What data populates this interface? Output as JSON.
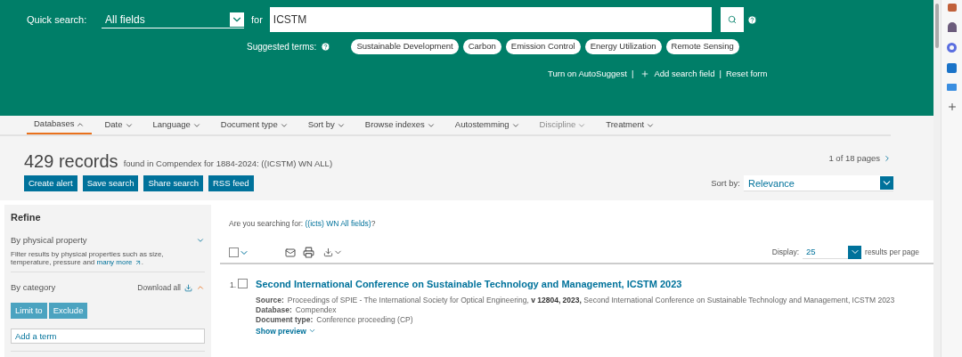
{
  "search": {
    "label": "Quick search:",
    "field": "All fields",
    "for_label": "for",
    "query": "ICSTM",
    "suggested_label": "Suggested terms:",
    "suggested_terms": [
      "Sustainable Development",
      "Carbon",
      "Emission Control",
      "Energy Utilization",
      "Remote Sensing"
    ],
    "links": [
      "Turn on AutoSuggest",
      "Add search field",
      "Reset form"
    ],
    "separators": [
      "|",
      "|"
    ]
  },
  "tabs": [
    {
      "label": "Databases",
      "selected": true,
      "disabled": false
    },
    {
      "label": "Date",
      "selected": false,
      "disabled": false
    },
    {
      "label": "Language",
      "selected": false,
      "disabled": false
    },
    {
      "label": "Document type",
      "selected": false,
      "disabled": false
    },
    {
      "label": "Sort by",
      "selected": false,
      "disabled": false
    },
    {
      "label": "Browse indexes",
      "selected": false,
      "disabled": false
    },
    {
      "label": "Autostemming",
      "selected": false,
      "disabled": false
    },
    {
      "label": "Discipline",
      "selected": false,
      "disabled": true
    },
    {
      "label": "Treatment",
      "selected": false,
      "disabled": false
    }
  ],
  "results_header": {
    "count": "429 records",
    "summary": "found in Compendex for 1884-2024: ((ICSTM) WN ALL)",
    "pages": "1 of 18 pages",
    "actions": [
      "Create alert",
      "Save search",
      "Share search",
      "RSS feed"
    ],
    "sort_label": "Sort by:",
    "sort_value": "Relevance"
  },
  "refine": {
    "title": "Refine",
    "sections": [
      {
        "kind": "info",
        "title": "By physical property",
        "expanded": false,
        "text": "Filter results by physical properties such as size, temperature, pressure and",
        "link": "many more",
        "end": "."
      },
      {
        "kind": "category",
        "title": "By category",
        "expanded": true,
        "download": "Download all",
        "buttons": [
          "Limit to",
          "Exclude"
        ],
        "placeholder": "Add a term"
      }
    ]
  },
  "results": {
    "suggestion_label": "Are you searching for:",
    "suggestion_link": "((icts) WN All fields)",
    "suggestion_end": "?",
    "select_all_checked": false,
    "display_label": "Display:",
    "display_value": "25",
    "display_suffix": "results per page",
    "items": [
      {
        "number": "1.",
        "checked": false,
        "title": "Second International Conference on Sustainable Technology and Management, ICSTM 2023",
        "fields": [
          {
            "label": "Source:",
            "value": "Proceedings of SPIE - The International Society for Optical Engineering, **v 12804, 2023,** Second International Conference on Sustainable Technology and Management, ICSTM 2023"
          },
          {
            "label": "Database:",
            "value": "Compendex"
          },
          {
            "label": "Document type:",
            "value": "Conference proceeding (CP)"
          }
        ],
        "preview": "Show preview"
      }
    ]
  }
}
